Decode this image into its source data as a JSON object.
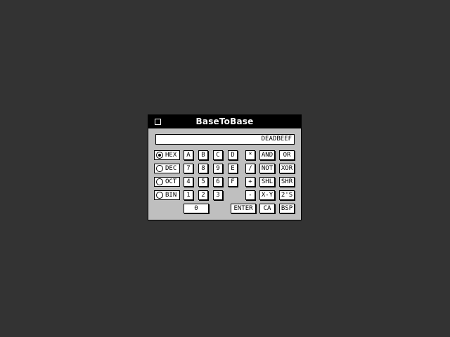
{
  "window": {
    "title": "BaseToBase"
  },
  "display": {
    "value": "DEADBEEF"
  },
  "modes": [
    {
      "label": "HEX",
      "selected": true
    },
    {
      "label": "DEC",
      "selected": false
    },
    {
      "label": "OCT",
      "selected": false
    },
    {
      "label": "BIN",
      "selected": false
    }
  ],
  "keys": {
    "a": "A",
    "b": "B",
    "c": "C",
    "d": "D",
    "e": "E",
    "f": "F",
    "n0": "0",
    "n1": "1",
    "n2": "2",
    "n3": "3",
    "n4": "4",
    "n5": "5",
    "n6": "6",
    "n7": "7",
    "n8": "8",
    "n9": "9",
    "mul": "*",
    "div": "/",
    "add": "+",
    "sub": "-",
    "and": "AND",
    "or": "OR",
    "not": "NOT",
    "xor": "XOR",
    "shl": "SHL",
    "shr": "SHR",
    "xy": "X-Y",
    "twos": "2'S",
    "enter": "ENTER",
    "ca": "CA",
    "bsp": "BSP"
  }
}
